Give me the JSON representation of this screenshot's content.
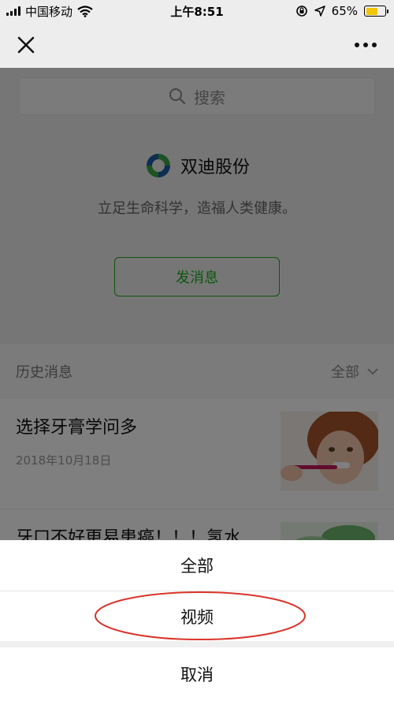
{
  "status_bar": {
    "carrier": "中国移动",
    "time": "上午8:51",
    "battery_percent": "65%",
    "battery_level": 0.65
  },
  "nav": {
    "close_icon": "close-icon",
    "more_icon": "more-icon"
  },
  "search": {
    "placeholder": "搜索"
  },
  "account": {
    "name": "双迪股份",
    "slogan": "立足生命科学，造福人类健康。",
    "send_message_label": "发消息"
  },
  "history": {
    "title": "历史消息",
    "filter_label": "全部"
  },
  "articles": [
    {
      "title": "选择牙膏学问多",
      "date": "2018年10月18日"
    },
    {
      "title": "牙口不好更易患癌！！！氢水"
    }
  ],
  "action_sheet": {
    "items": [
      "全部",
      "视频"
    ],
    "cancel_label": "取消"
  },
  "colors": {
    "accent_green": "#1aad19",
    "annotation_red": "#d9342b",
    "battery_yellow": "#f3c400"
  }
}
